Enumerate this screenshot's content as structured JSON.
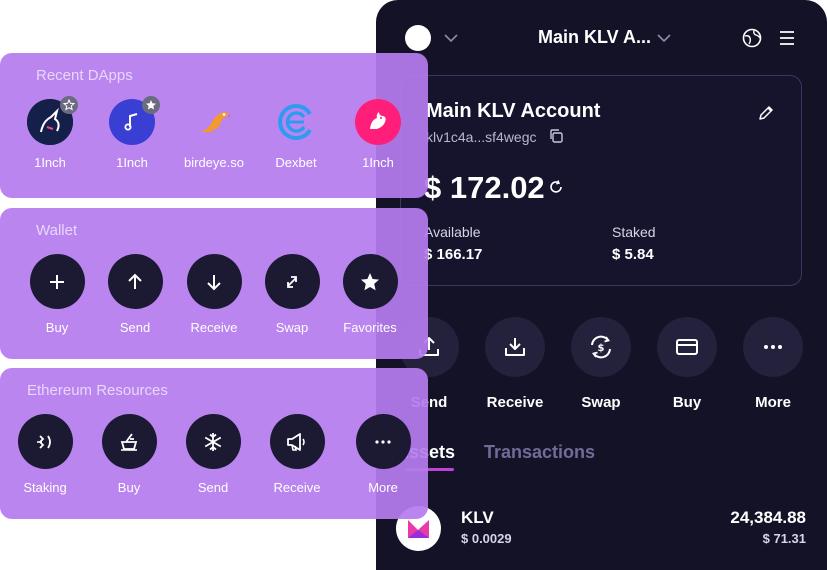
{
  "wallet": {
    "header": {
      "account_selector": "Main KLV A..."
    },
    "card": {
      "account_name": "Main KLV Account",
      "address": "klv1c4a...sf4wegc",
      "balance": "$ 172.02",
      "available_label": "Available",
      "available_value": "$ 166.17",
      "staked_label": "Staked",
      "staked_value": "$ 5.84"
    },
    "actions": [
      {
        "label": "Send",
        "icon": "upload-icon"
      },
      {
        "label": "Receive",
        "icon": "download-icon"
      },
      {
        "label": "Swap",
        "icon": "swap-dollar-icon"
      },
      {
        "label": "Buy",
        "icon": "credit-card-icon"
      },
      {
        "label": "More",
        "icon": "more-icon"
      }
    ],
    "tabs": [
      {
        "label": "Assets",
        "active": true
      },
      {
        "label": "Transactions",
        "active": false
      }
    ],
    "tokens": [
      {
        "symbol": "KLV",
        "price": "$ 0.0029",
        "amount": "24,384.88",
        "fiat": "$ 71.31"
      }
    ]
  },
  "recent_dapps": {
    "title": "Recent DApps",
    "items": [
      {
        "label": "1Inch",
        "icon": "unicorn-icon",
        "favorite": true
      },
      {
        "label": "1Inch",
        "icon": "music-note-icon",
        "favorite": true
      },
      {
        "label": "birdeye.so",
        "icon": "bird-icon",
        "favorite": false
      },
      {
        "label": "Dexbet",
        "icon": "dexbet-icon",
        "favorite": false
      },
      {
        "label": "1Inch",
        "icon": "uniswap-icon",
        "favorite": false
      }
    ]
  },
  "wallet_panel": {
    "title": "Wallet",
    "items": [
      {
        "label": "Buy",
        "icon": "plus-icon"
      },
      {
        "label": "Send",
        "icon": "arrow-up-icon"
      },
      {
        "label": "Receive",
        "icon": "arrow-down-icon"
      },
      {
        "label": "Swap",
        "icon": "swap-icon"
      },
      {
        "label": "Favorites",
        "icon": "star-icon"
      }
    ]
  },
  "ethereum_resources": {
    "title": "Ethereum Resources",
    "items": [
      {
        "label": "Staking",
        "icon": "staking-icon"
      },
      {
        "label": "Buy",
        "icon": "bucket-icon"
      },
      {
        "label": "Send",
        "icon": "snowflake-icon"
      },
      {
        "label": "Receive",
        "icon": "megaphone-icon"
      },
      {
        "label": "More",
        "icon": "more-icon"
      }
    ]
  },
  "colors": {
    "panel_bg": "#b57cee",
    "phone_bg": "#141226",
    "tab_accent": "#c042d8",
    "inactive_tab": "#6f6c9a"
  }
}
